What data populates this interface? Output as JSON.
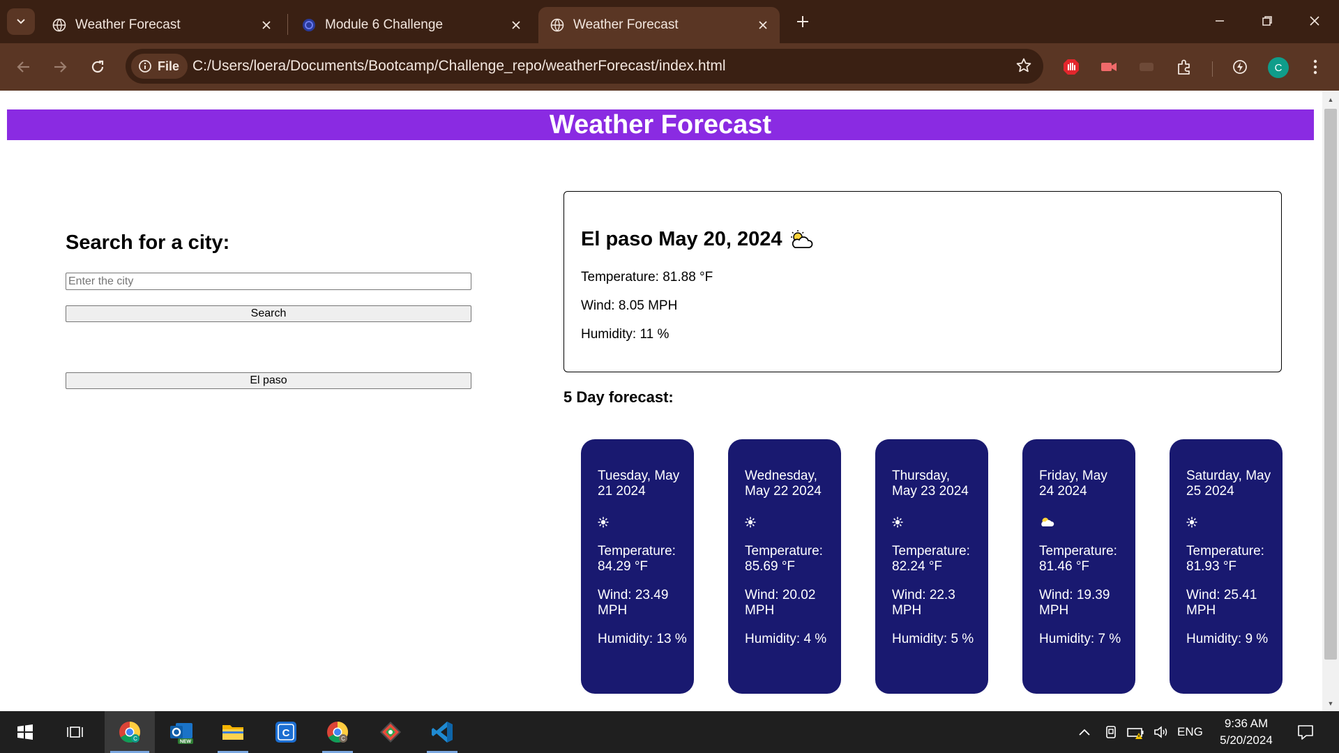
{
  "browser": {
    "tabs": [
      {
        "title": "Weather Forecast",
        "active": false
      },
      {
        "title": "Module 6 Challenge",
        "active": false
      },
      {
        "title": "Weather Forecast",
        "active": true
      }
    ],
    "address": {
      "scheme_label": "File",
      "url": "C:/Users/loera/Documents/Bootcamp/Challenge_repo/weatherForecast/index.html"
    },
    "profile_initial": "C"
  },
  "page": {
    "header_title": "Weather Forecast",
    "search": {
      "title": "Search for a city:",
      "placeholder": "Enter the city",
      "value": "",
      "button_label": "Search"
    },
    "history": [
      "El paso"
    ],
    "current": {
      "title": "El paso May 20, 2024",
      "icon": "partly-cloudy-icon",
      "temperature": "Temperature: 81.88 °F",
      "wind": "Wind: 8.05 MPH",
      "humidity": "Humidity: 11 %"
    },
    "forecast_title": "5 Day forecast:",
    "forecast": [
      {
        "date": "Tuesday, May 21 2024",
        "icon": "sun-icon",
        "temperature": "Temperature: 84.29 °F",
        "wind": "Wind: 23.49 MPH",
        "humidity": "Humidity: 13 %"
      },
      {
        "date": "Wednesday, May 22 2024",
        "icon": "sun-icon",
        "temperature": "Temperature: 85.69 °F",
        "wind": "Wind: 20.02 MPH",
        "humidity": "Humidity: 4 %"
      },
      {
        "date": "Thursday, May 23 2024",
        "icon": "sun-icon",
        "temperature": "Temperature: 82.24 °F",
        "wind": "Wind: 22.3 MPH",
        "humidity": "Humidity: 5 %"
      },
      {
        "date": "Friday, May 24 2024",
        "icon": "partly-cloudy-icon",
        "temperature": "Temperature: 81.46 °F",
        "wind": "Wind: 19.39 MPH",
        "humidity": "Humidity: 7 %"
      },
      {
        "date": "Saturday, May 25 2024",
        "icon": "sun-icon",
        "temperature": "Temperature: 81.93 °F",
        "wind": "Wind: 25.41 MPH",
        "humidity": "Humidity: 9 %"
      }
    ]
  },
  "taskbar": {
    "language": "ENG",
    "time": "9:36 AM",
    "date": "5/20/2024"
  },
  "colors": {
    "header_bg": "#8a2be2",
    "forecast_card_bg": "#191970",
    "chrome_dark": "#3a2013",
    "chrome_mid": "#5a3624"
  }
}
